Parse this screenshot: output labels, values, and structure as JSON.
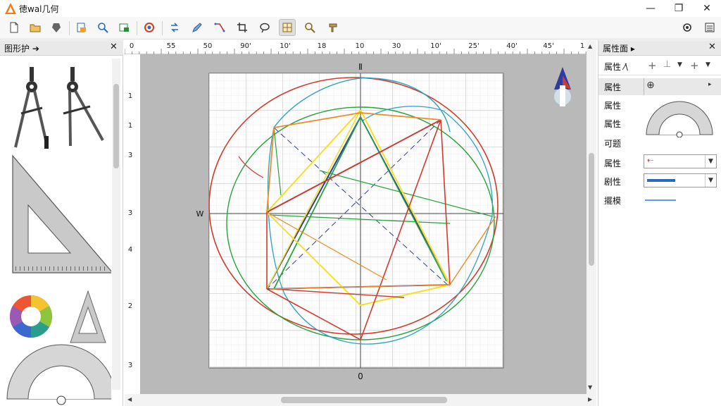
{
  "app": {
    "title": "徳wal几何",
    "window_controls": {
      "minimize": "—",
      "maximize": "❐",
      "close": "✕"
    }
  },
  "toolbar": {
    "icons": [
      "new-file-icon",
      "open-folder-icon",
      "save-icon",
      "export-icon",
      "zoom-icon",
      "image-icon",
      "refresh-icon",
      "redo-icon",
      "pen-icon",
      "transform-icon",
      "crop-icon",
      "lasso-icon",
      "grid-select-icon",
      "search-icon",
      "brush-icon",
      "settings-icon",
      "list-icon"
    ],
    "active": "grid-select-icon"
  },
  "left_panel": {
    "title": "图形护 ➔",
    "close": "✕",
    "tools": [
      "compass-tool",
      "compass-with-pencil-tool",
      "set-square-tool",
      "color-wheel-tool",
      "triangle-frame-tool",
      "protractor-tool"
    ]
  },
  "rulers": {
    "top_labels": [
      "0",
      "55",
      "50",
      "90'",
      "10'",
      "18",
      "10",
      "30",
      "10'",
      "25'",
      "40'",
      "45'",
      "1"
    ],
    "left_labels": [
      "1",
      "1",
      "3",
      "3",
      "4",
      "2",
      "3"
    ]
  },
  "canvas": {
    "label_top": "Ⅱ",
    "label_left": "W",
    "label_bottom": "0",
    "colors": {
      "red": "#d33a2c",
      "blue": "#2d3c9e",
      "green": "#23a33a",
      "yellow": "#f4e02a",
      "orange": "#f08a24",
      "cyan": "#2aa1c4",
      "grid": "#c9c9c9"
    }
  },
  "right_panel": {
    "title": "属性面 ▸",
    "close": "✕",
    "row1_label": "属性 ⁄\\",
    "row2_label": "属性",
    "row3_label": "属性",
    "row4_label": "属性",
    "row5_label": "可题",
    "row6_label": "属性",
    "row7_label": "剧性",
    "row8_label": "擺模"
  }
}
